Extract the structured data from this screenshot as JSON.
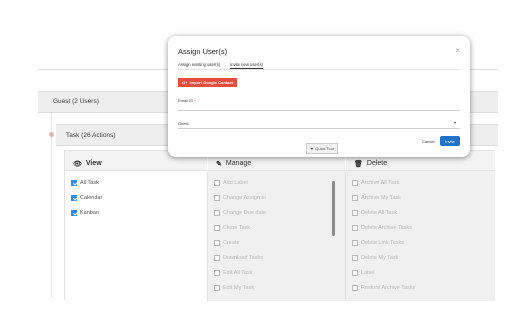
{
  "group": {
    "title": "Guest (2 Users)"
  },
  "task": {
    "title": "Task (26 Actions)"
  },
  "columns": {
    "view": {
      "title": "View",
      "items": [
        "All Task",
        "Calendar",
        "Kanban"
      ]
    },
    "manage": {
      "title": "Manage",
      "items": [
        "Add Label",
        "Change Assign to",
        "Change Due date",
        "Clone Task",
        "Create",
        "Download Tasks",
        "Edit All Task",
        "Edit My Task"
      ]
    },
    "delete": {
      "title": "Delete",
      "items": [
        "Archive All Task",
        "Archive My Task",
        "Delete All Task",
        "Delete Archive Tasks",
        "Delete Link Tasks",
        "Delete My Task",
        "Label",
        "Restore Archive Tasks"
      ]
    }
  },
  "modal": {
    "title": "Assign User(s)",
    "close": "×",
    "tabs": [
      "Assign existing user(s)",
      "Invite new user(s)"
    ],
    "google_button": "Import Google Contact",
    "google_icon": "G+",
    "email_label": "Email ID",
    "email_required": "*",
    "role_value": "Guest",
    "dropdown_arrow": "▾",
    "cancel": "Cancel",
    "invite": "Invite"
  },
  "quick_tour": "Quick Tour",
  "colors": {
    "accent": "#2d8cf0",
    "invite": "#1e73c8",
    "google": "#e74c3c"
  }
}
